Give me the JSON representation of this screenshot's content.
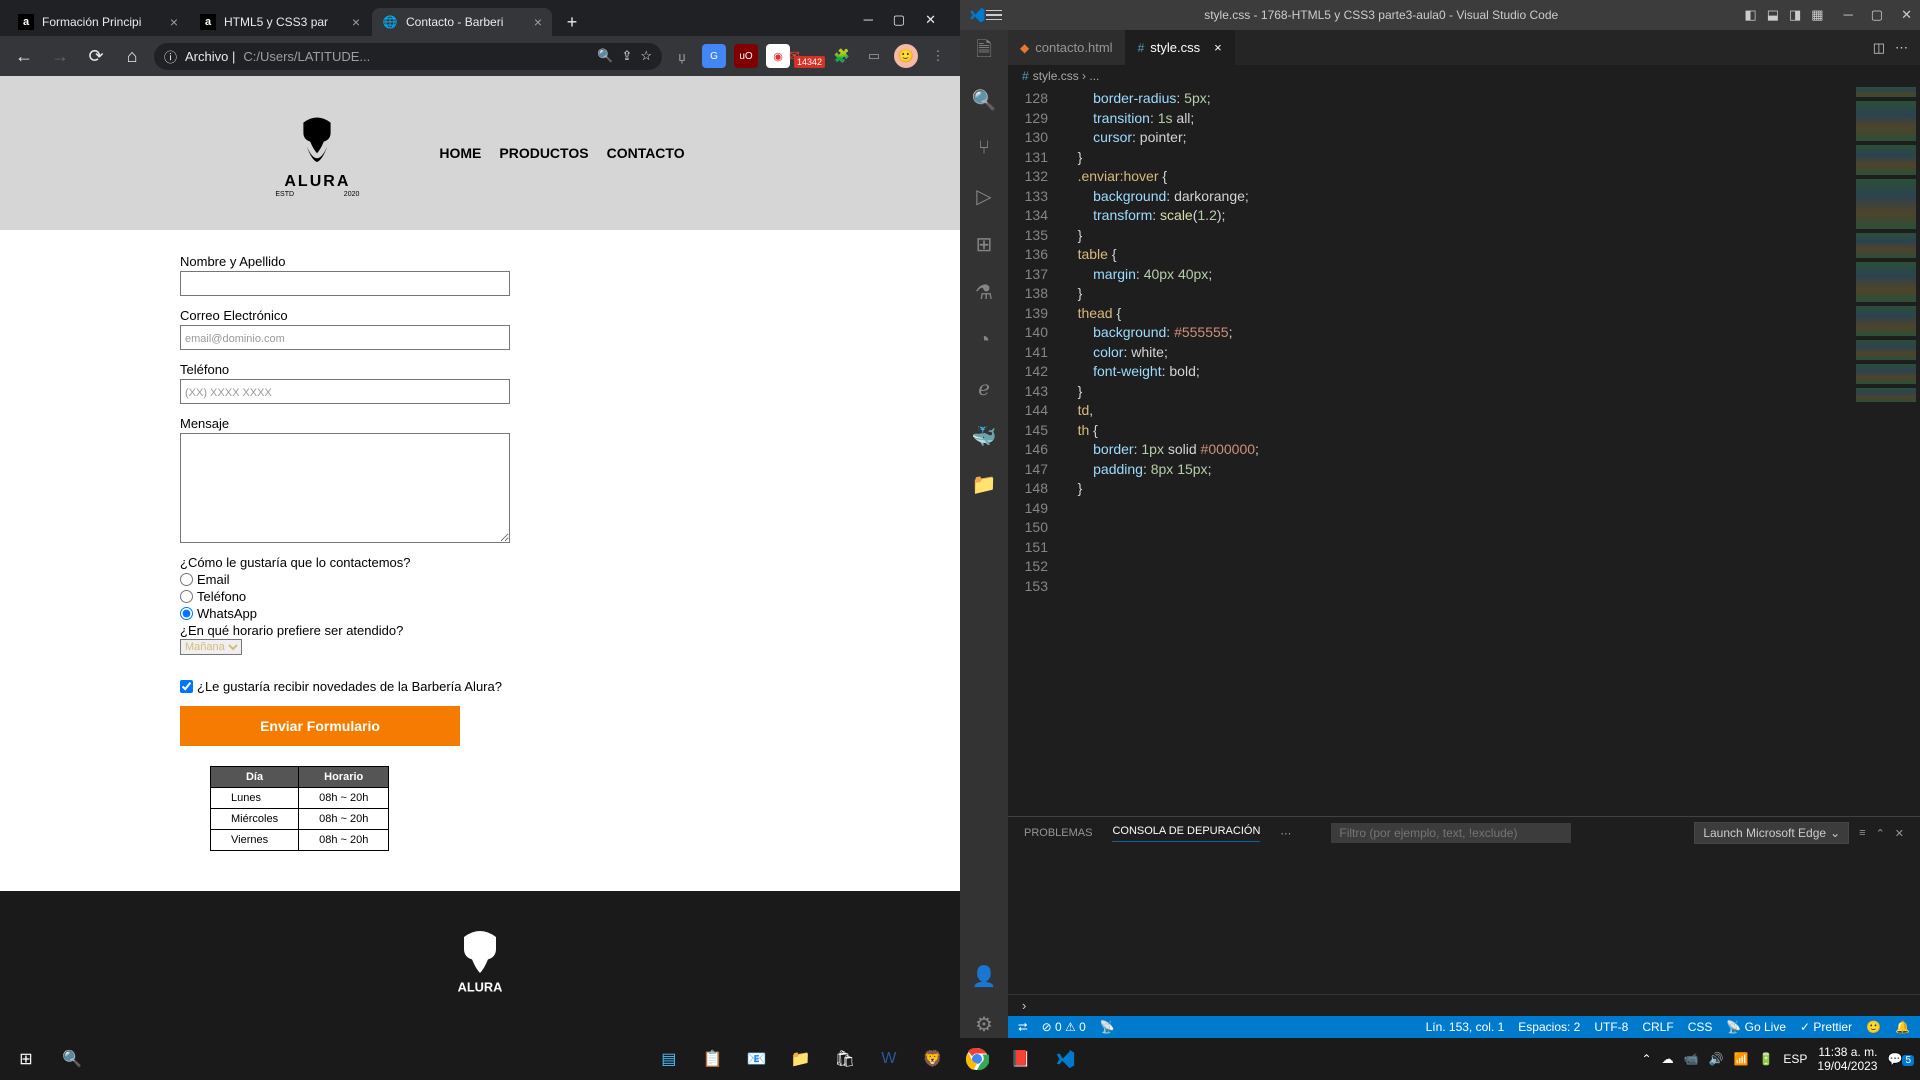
{
  "chrome": {
    "tabs": [
      {
        "fav": "a",
        "title": "Formación Principi"
      },
      {
        "fav": "a",
        "title": "HTML5 y CSS3 par"
      },
      {
        "fav": "◐",
        "title": "Contacto - Barberi"
      }
    ],
    "url_prefix": "Archivo | ",
    "url": "C:/Users/LATITUDE...",
    "info_icon": "ⓘ",
    "ext_badge": "14342"
  },
  "page": {
    "logo_name": "ALURA",
    "logo_left": "ESTD",
    "logo_right": "2020",
    "nav": [
      "HOME",
      "PRODUCTOS",
      "CONTACTO"
    ],
    "labels": {
      "name": "Nombre y Apellido",
      "email": "Correo Electrónico",
      "phone": "Teléfono",
      "msg": "Mensaje",
      "contact_q": "¿Cómo le gustaría que lo contactemos?",
      "r1": "Email",
      "r2": "Teléfono",
      "r3": "WhatsApp",
      "sched_q": "¿En qué horario prefiere ser atendido?",
      "sel": "Mañana",
      "news": "¿Le gustaría recibir novedades de la Barbería Alura?",
      "submit": "Enviar Formulario"
    },
    "ph": {
      "email": "email@dominio.com",
      "phone": "(XX) XXXX XXXX"
    },
    "table": {
      "head": [
        "Día",
        "Horario"
      ],
      "rows": [
        [
          "Lunes",
          "08h ~ 20h"
        ],
        [
          "Miércoles",
          "08h ~ 20h"
        ],
        [
          "Viernes",
          "08h ~ 20h"
        ]
      ]
    }
  },
  "vs": {
    "title": "style.css - 1768-HTML5 y CSS3 parte3-aula0 - Visual Studio Code",
    "tabs": [
      {
        "name": "contacto.html",
        "icon": "⬥",
        "color": "#e37933"
      },
      {
        "name": "style.css",
        "icon": "#",
        "color": "#519aba"
      }
    ],
    "crumb": "style.css › ...",
    "lines": [
      {
        "n": 128,
        "html": "        <span class='b'>border-radius</span><span class='w'>: </span><span class='n'>5px</span><span class='w'>;</span>"
      },
      {
        "n": 129,
        "html": "        <span class='b'>transition</span><span class='w'>: </span><span class='n'>1s</span><span class='w'> all;</span>"
      },
      {
        "n": 130,
        "html": "        <span class='b'>cursor</span><span class='w'>: pointer;</span>"
      },
      {
        "n": 131,
        "html": "    <span class='w'>}</span>"
      },
      {
        "n": 132,
        "html": ""
      },
      {
        "n": 133,
        "html": "    <span class='c-sel'>.enviar:hover</span> <span class='w'>{</span>"
      },
      {
        "n": 134,
        "html": "        <span class='b'>background</span><span class='w'>: darkorange;</span>"
      },
      {
        "n": 135,
        "html": "        <span class='b'>transform</span><span class='w'>: </span><span class='y'>scale</span><span class='w'>(</span><span class='n'>1.2</span><span class='w'>);</span>"
      },
      {
        "n": 136,
        "html": "    <span class='w'>}</span>"
      },
      {
        "n": 137,
        "html": ""
      },
      {
        "n": 138,
        "html": "    <span class='c-sel'>table</span> <span class='w'>{</span>"
      },
      {
        "n": 139,
        "html": "        <span class='b'>margin</span><span class='w'>: </span><span class='n'>40px 40px</span><span class='w'>;</span>"
      },
      {
        "n": 140,
        "html": "    <span class='w'>}</span>"
      },
      {
        "n": 141,
        "html": ""
      },
      {
        "n": 142,
        "html": "    <span class='c-sel'>thead</span> <span class='w'>{</span>"
      },
      {
        "n": 143,
        "html": "        <span class='b'>background</span><span class='w'>: </span><span class='o'>#555555</span><span class='w'>;</span>"
      },
      {
        "n": 144,
        "html": "        <span class='b'>color</span><span class='w'>: white;</span>"
      },
      {
        "n": 145,
        "html": "        <span class='b'>font-weight</span><span class='w'>: bold;</span>"
      },
      {
        "n": 146,
        "html": "    <span class='w'>}</span>"
      },
      {
        "n": 147,
        "html": ""
      },
      {
        "n": 148,
        "html": "    <span class='c-sel'>td</span><span class='w'>,</span>"
      },
      {
        "n": 149,
        "html": "    <span class='c-sel'>th</span> <span class='w'>{</span>"
      },
      {
        "n": 150,
        "html": "        <span class='b'>border</span><span class='w'>: </span><span class='n'>1px</span><span class='w'> solid </span><span class='o'>#000000</span><span class='w'>;</span>"
      },
      {
        "n": 151,
        "html": "        <span class='b'>padding</span><span class='w'>: </span><span class='n'>8px 15px</span><span class='w'>;</span>"
      },
      {
        "n": 152,
        "html": "    <span class='w'>}</span>"
      },
      {
        "n": 153,
        "html": ""
      }
    ],
    "panel": {
      "problemas": "PROBLEMAS",
      "consola": "CONSOLA DE DEPURACIÓN",
      "filter_ph": "Filtro (por ejemplo, text, !exclude)",
      "launch": "Launch Microsoft Edge"
    },
    "status": {
      "errors": "⊘ 0 ⚠ 0",
      "golive": "Go Live",
      "prettier": "Prettier",
      "ln": "Lín. 153, col. 1",
      "spaces": "Espacios: 2",
      "enc": "UTF-8",
      "eol": "CRLF",
      "lang": "CSS"
    }
  },
  "taskbar": {
    "time": "11:38 a. m.",
    "date": "19/04/2023",
    "lang": "ESP",
    "notif": "5"
  }
}
